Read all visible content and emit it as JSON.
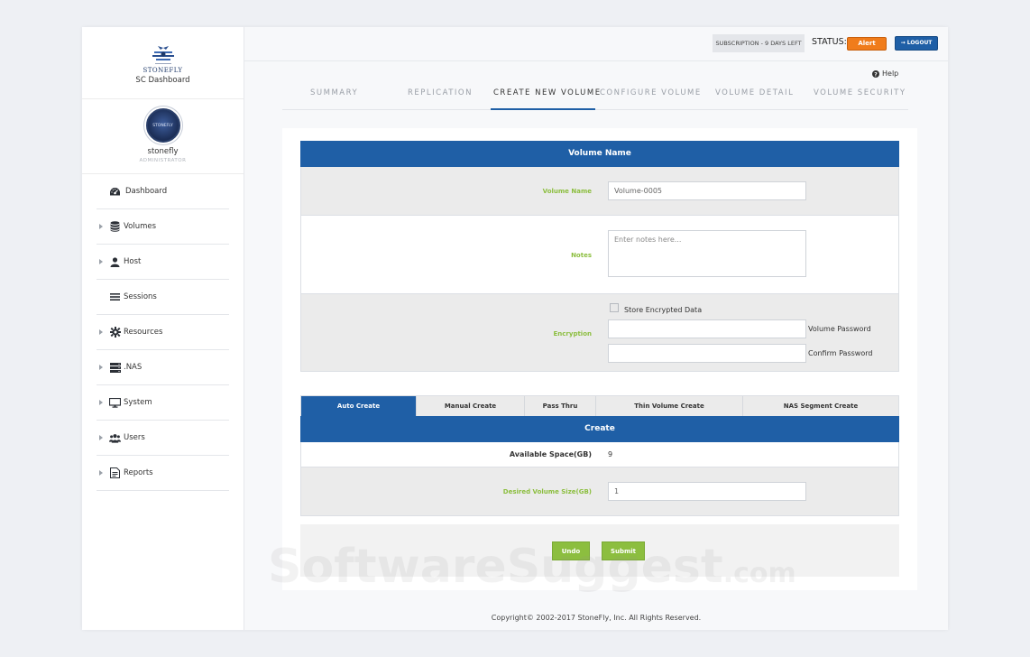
{
  "brand": {
    "logo_word": "STONEFLY",
    "app_title": "SC Dashboard"
  },
  "profile": {
    "avatar_text": "STONEFLY",
    "name": "stonefly",
    "role": "ADMINISTRATOR"
  },
  "nav": {
    "items": [
      {
        "label": "Dashboard",
        "icon": "dashboard-icon"
      },
      {
        "label": "Volumes",
        "icon": "database-icon"
      },
      {
        "label": "Host",
        "icon": "user-icon"
      },
      {
        "label": "Sessions",
        "icon": "list-icon"
      },
      {
        "label": "Resources",
        "icon": "gear-icon"
      },
      {
        "label": ".NAS",
        "icon": "server-icon"
      },
      {
        "label": "System",
        "icon": "monitor-icon"
      },
      {
        "label": "Users",
        "icon": "users-icon"
      },
      {
        "label": "Reports",
        "icon": "report-icon"
      }
    ]
  },
  "topbar": {
    "subscription": "SUBSCRIPTION - 9 DAYS LEFT",
    "status_label": "STATUS:",
    "alert_label": "Alert",
    "logout_label": "LOGOUT"
  },
  "help_label": "Help",
  "tabs": [
    "SUMMARY",
    "REPLICATION",
    "CREATE NEW VOLUME",
    "CONFIGURE VOLUME",
    "VOLUME DETAIL",
    "VOLUME SECURITY"
  ],
  "volume_section": {
    "header": "Volume Name",
    "name_label": "Volume Name",
    "name_value": "Volume-0005",
    "notes_label": "Notes",
    "notes_placeholder": "Enter notes here...",
    "encryption_label": "Encryption",
    "store_encrypted_label": "Store Encrypted Data",
    "volume_password_label": "Volume Password",
    "confirm_password_label": "Confirm Password"
  },
  "sub_tabs": [
    "Auto Create",
    "Manual Create",
    "Pass Thru",
    "Thin Volume Create",
    "NAS Segment Create"
  ],
  "create_section": {
    "header": "Create",
    "available_label": "Available Space(GB)",
    "available_value": "9",
    "desired_label": "Desired Volume Size(GB)",
    "desired_value": "1"
  },
  "actions": {
    "undo_label": "Undo",
    "submit_label": "Submit"
  },
  "watermark": {
    "main": "SoftwareSuggest",
    "suffix": ".com"
  },
  "footer": "Copyright© 2002-2017 StoneFly, Inc. All Rights Reserved.",
  "colors": {
    "primary_blue": "#1f5fa6",
    "accent_green": "#8cbe3f",
    "alert_orange": "#f07c1b"
  }
}
